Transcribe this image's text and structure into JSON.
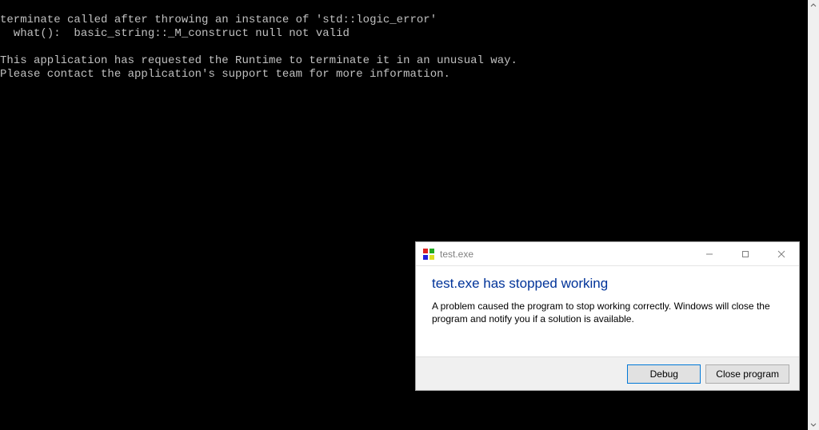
{
  "console": {
    "lines": [
      "terminate called after throwing an instance of 'std::logic_error'",
      "  what():  basic_string::_M_construct null not valid",
      "",
      "This application has requested the Runtime to terminate it in an unusual way.",
      "Please contact the application's support team for more information."
    ]
  },
  "dialog": {
    "title": "test.exe",
    "heading": "test.exe has stopped working",
    "body": "A problem caused the program to stop working correctly. Windows will close the program and notify you if a solution is available.",
    "buttons": {
      "debug": "Debug",
      "close": "Close program"
    }
  }
}
